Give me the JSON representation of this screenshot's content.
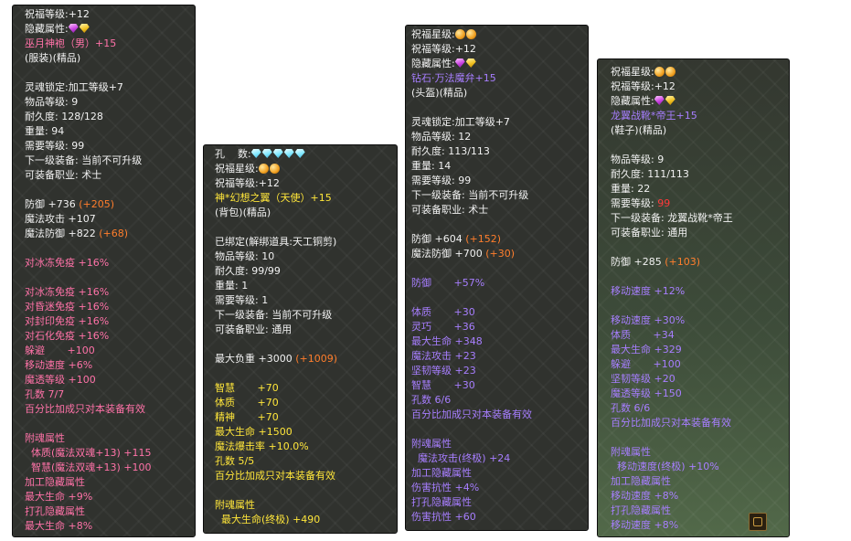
{
  "colors": {
    "white": "#f2f2f2",
    "yellow": "#ffe63a",
    "pink": "#ff72a8",
    "violet": "#a77eff",
    "orange": "#ff7e2c",
    "red": "#ff3a3a"
  },
  "icons": {
    "purple_gem": "purple-diamond-gem-icon",
    "yellow_gem": "yellow-diamond-gem-icon",
    "cyan_gem": "cyan-diamond-gem-icon",
    "star": "gold-star-orb-icon",
    "slot": "item-slot-icon"
  },
  "tooltips": [
    {
      "lines": [
        {
          "c": "t",
          "segs": [
            {
              "t": "祝福等级:+12"
            }
          ]
        },
        {
          "c": "t",
          "segs": [
            {
              "t": "隐藏属性:"
            },
            {
              "icons": [
                "purple",
                "yellow"
              ]
            }
          ]
        },
        {
          "c": "p",
          "segs": [
            {
              "t": "巫月神袍（男）+15"
            }
          ]
        },
        {
          "c": "t",
          "segs": [
            {
              "t": "(服装)(精品)"
            }
          ]
        },
        {
          "c": "t",
          "segs": [
            {
              "t": ""
            }
          ]
        },
        {
          "c": "t",
          "segs": [
            {
              "t": "灵魂锁定:加工等级+7"
            }
          ]
        },
        {
          "c": "t",
          "segs": [
            {
              "t": "物品等级: 9"
            }
          ]
        },
        {
          "c": "t",
          "segs": [
            {
              "t": "耐久度: 128/128"
            }
          ]
        },
        {
          "c": "t",
          "segs": [
            {
              "t": "重量: 94"
            }
          ]
        },
        {
          "c": "t",
          "segs": [
            {
              "t": "需要等级: 99"
            }
          ]
        },
        {
          "c": "t",
          "segs": [
            {
              "t": "下一级装备: 当前不可升级"
            }
          ]
        },
        {
          "c": "t",
          "segs": [
            {
              "t": "可装备职业: 术士"
            }
          ]
        },
        {
          "c": "t",
          "segs": [
            {
              "t": ""
            }
          ]
        },
        {
          "c": "t",
          "segs": [
            {
              "t": "防御 +736 "
            },
            {
              "t": "(+205)",
              "c": "o"
            }
          ]
        },
        {
          "c": "t",
          "segs": [
            {
              "t": "魔法攻击 +107"
            }
          ]
        },
        {
          "c": "t",
          "segs": [
            {
              "t": "魔法防御 +822 "
            },
            {
              "t": "(+68)",
              "c": "o"
            }
          ]
        },
        {
          "c": "t",
          "segs": [
            {
              "t": ""
            }
          ]
        },
        {
          "c": "p",
          "segs": [
            {
              "t": "对冰冻免疫 +16%"
            }
          ]
        },
        {
          "c": "t",
          "segs": [
            {
              "t": ""
            }
          ]
        },
        {
          "c": "p",
          "segs": [
            {
              "t": "对冰冻免疫 +16%"
            }
          ]
        },
        {
          "c": "p",
          "segs": [
            {
              "t": "对昏迷免疫 +16%"
            }
          ]
        },
        {
          "c": "p",
          "segs": [
            {
              "t": "对封印免疫 +16%"
            }
          ]
        },
        {
          "c": "p",
          "segs": [
            {
              "t": "对石化免疫 +16%"
            }
          ]
        },
        {
          "c": "p",
          "segs": [
            {
              "t": "躲避       +100"
            }
          ]
        },
        {
          "c": "p",
          "segs": [
            {
              "t": "移动速度 +6%"
            }
          ]
        },
        {
          "c": "p",
          "segs": [
            {
              "t": "魔透等级 +100"
            }
          ]
        },
        {
          "c": "p",
          "segs": [
            {
              "t": "孔数 7/7"
            }
          ]
        },
        {
          "c": "p",
          "segs": [
            {
              "t": "百分比加成只对本装备有效"
            }
          ]
        },
        {
          "c": "t",
          "segs": [
            {
              "t": ""
            }
          ]
        },
        {
          "c": "p",
          "segs": [
            {
              "t": "附魂属性"
            }
          ]
        },
        {
          "c": "p",
          "segs": [
            {
              "t": "  体质(魔法双魂+13) +115"
            }
          ]
        },
        {
          "c": "p",
          "segs": [
            {
              "t": "  智慧(魔法双魂+13) +100"
            }
          ]
        },
        {
          "c": "p",
          "segs": [
            {
              "t": "加工隐藏属性"
            }
          ]
        },
        {
          "c": "p",
          "segs": [
            {
              "t": "最大生命 +9%"
            }
          ]
        },
        {
          "c": "p",
          "segs": [
            {
              "t": "打孔隐藏属性"
            }
          ]
        },
        {
          "c": "p",
          "segs": [
            {
              "t": "最大生命 +8%"
            }
          ]
        }
      ]
    },
    {
      "lines": [
        {
          "c": "t",
          "segs": [
            {
              "t": "孔    数:"
            },
            {
              "icons": [
                "cyan",
                "cyan",
                "cyan",
                "cyan",
                "cyan"
              ]
            }
          ]
        },
        {
          "c": "t",
          "segs": [
            {
              "t": "祝福星级:"
            },
            {
              "stars": 2
            }
          ]
        },
        {
          "c": "t",
          "segs": [
            {
              "t": "祝福等级:+12"
            }
          ]
        },
        {
          "c": "y",
          "segs": [
            {
              "t": "神*幻想之翼（天使）+15"
            }
          ]
        },
        {
          "c": "t",
          "segs": [
            {
              "t": "(背包)(精品)"
            }
          ]
        },
        {
          "c": "t",
          "segs": [
            {
              "t": ""
            }
          ]
        },
        {
          "c": "t",
          "segs": [
            {
              "t": "已绑定(解绑道具:天工铜剪)"
            }
          ]
        },
        {
          "c": "t",
          "segs": [
            {
              "t": "物品等级: 10"
            }
          ]
        },
        {
          "c": "t",
          "segs": [
            {
              "t": "耐久度: 99/99"
            }
          ]
        },
        {
          "c": "t",
          "segs": [
            {
              "t": "重量: 1"
            }
          ]
        },
        {
          "c": "t",
          "segs": [
            {
              "t": "需要等级: 1"
            }
          ]
        },
        {
          "c": "t",
          "segs": [
            {
              "t": "下一级装备: 当前不可升级"
            }
          ]
        },
        {
          "c": "t",
          "segs": [
            {
              "t": "可装备职业: 通用"
            }
          ]
        },
        {
          "c": "t",
          "segs": [
            {
              "t": ""
            }
          ]
        },
        {
          "c": "t",
          "segs": [
            {
              "t": "最大负重 +3000 "
            },
            {
              "t": "(+1009)",
              "c": "o"
            }
          ]
        },
        {
          "c": "t",
          "segs": [
            {
              "t": ""
            }
          ]
        },
        {
          "c": "y",
          "segs": [
            {
              "t": "智慧       +70"
            }
          ]
        },
        {
          "c": "y",
          "segs": [
            {
              "t": "体质       +70"
            }
          ]
        },
        {
          "c": "y",
          "segs": [
            {
              "t": "精神       +70"
            }
          ]
        },
        {
          "c": "y",
          "segs": [
            {
              "t": "最大生命 +1500"
            }
          ]
        },
        {
          "c": "y",
          "segs": [
            {
              "t": "魔法爆击率 +10.0%"
            }
          ]
        },
        {
          "c": "y",
          "segs": [
            {
              "t": "孔数 5/5"
            }
          ]
        },
        {
          "c": "y",
          "segs": [
            {
              "t": "百分比加成只对本装备有效"
            }
          ]
        },
        {
          "c": "t",
          "segs": [
            {
              "t": ""
            }
          ]
        },
        {
          "c": "y",
          "segs": [
            {
              "t": "附魂属性"
            }
          ]
        },
        {
          "c": "y",
          "segs": [
            {
              "t": "  最大生命(终极) +490"
            }
          ]
        }
      ]
    },
    {
      "lines": [
        {
          "c": "t",
          "segs": [
            {
              "t": "祝福星级:"
            },
            {
              "stars": 2
            }
          ]
        },
        {
          "c": "t",
          "segs": [
            {
              "t": "祝福等级:+12"
            }
          ]
        },
        {
          "c": "t",
          "segs": [
            {
              "t": "隐藏属性:"
            },
            {
              "icons": [
                "purple",
                "yellow"
              ]
            }
          ]
        },
        {
          "c": "v",
          "segs": [
            {
              "t": "钻石·万法魔弁+15"
            }
          ]
        },
        {
          "c": "t",
          "segs": [
            {
              "t": "(头盔)(精品)"
            }
          ]
        },
        {
          "c": "t",
          "segs": [
            {
              "t": ""
            }
          ]
        },
        {
          "c": "t",
          "segs": [
            {
              "t": "灵魂锁定:加工等级+7"
            }
          ]
        },
        {
          "c": "t",
          "segs": [
            {
              "t": "物品等级: 12"
            }
          ]
        },
        {
          "c": "t",
          "segs": [
            {
              "t": "耐久度: 113/113"
            }
          ]
        },
        {
          "c": "t",
          "segs": [
            {
              "t": "重量: 14"
            }
          ]
        },
        {
          "c": "t",
          "segs": [
            {
              "t": "需要等级: 99"
            }
          ]
        },
        {
          "c": "t",
          "segs": [
            {
              "t": "下一级装备: 当前不可升级"
            }
          ]
        },
        {
          "c": "t",
          "segs": [
            {
              "t": "可装备职业: 术士"
            }
          ]
        },
        {
          "c": "t",
          "segs": [
            {
              "t": ""
            }
          ]
        },
        {
          "c": "t",
          "segs": [
            {
              "t": "防御 +604 "
            },
            {
              "t": "(+152)",
              "c": "o"
            }
          ]
        },
        {
          "c": "t",
          "segs": [
            {
              "t": "魔法防御 +700 "
            },
            {
              "t": "(+30)",
              "c": "o"
            }
          ]
        },
        {
          "c": "t",
          "segs": [
            {
              "t": ""
            }
          ]
        },
        {
          "c": "v",
          "segs": [
            {
              "t": "防御       +57%"
            }
          ]
        },
        {
          "c": "t",
          "segs": [
            {
              "t": ""
            }
          ]
        },
        {
          "c": "v",
          "segs": [
            {
              "t": "体质       +30"
            }
          ]
        },
        {
          "c": "v",
          "segs": [
            {
              "t": "灵巧       +36"
            }
          ]
        },
        {
          "c": "v",
          "segs": [
            {
              "t": "最大生命 +348"
            }
          ]
        },
        {
          "c": "v",
          "segs": [
            {
              "t": "魔法攻击 +23"
            }
          ]
        },
        {
          "c": "v",
          "segs": [
            {
              "t": "坚韧等级 +23"
            }
          ]
        },
        {
          "c": "v",
          "segs": [
            {
              "t": "智慧       +30"
            }
          ]
        },
        {
          "c": "v",
          "segs": [
            {
              "t": "孔数 6/6"
            }
          ]
        },
        {
          "c": "v",
          "segs": [
            {
              "t": "百分比加成只对本装备有效"
            }
          ]
        },
        {
          "c": "t",
          "segs": [
            {
              "t": ""
            }
          ]
        },
        {
          "c": "v",
          "segs": [
            {
              "t": "附魂属性"
            }
          ]
        },
        {
          "c": "v",
          "segs": [
            {
              "t": "  魔法攻击(终极) +24"
            }
          ]
        },
        {
          "c": "v",
          "segs": [
            {
              "t": "加工隐藏属性"
            }
          ]
        },
        {
          "c": "v",
          "segs": [
            {
              "t": "伤害抗性 +4%"
            }
          ]
        },
        {
          "c": "v",
          "segs": [
            {
              "t": "打孔隐藏属性"
            }
          ]
        },
        {
          "c": "v",
          "segs": [
            {
              "t": "伤害抗性 +60"
            }
          ]
        }
      ]
    },
    {
      "lines": [
        {
          "c": "t",
          "segs": [
            {
              "t": "祝福星级:"
            },
            {
              "stars": 2
            }
          ]
        },
        {
          "c": "t",
          "segs": [
            {
              "t": "祝福等级:+12"
            }
          ]
        },
        {
          "c": "t",
          "segs": [
            {
              "t": "隐藏属性:"
            },
            {
              "icons": [
                "purple",
                "yellow"
              ]
            }
          ]
        },
        {
          "c": "v",
          "segs": [
            {
              "t": "龙翼战靴*帝王+15"
            }
          ]
        },
        {
          "c": "t",
          "segs": [
            {
              "t": "(鞋子)(精品)"
            }
          ]
        },
        {
          "c": "t",
          "segs": [
            {
              "t": ""
            }
          ]
        },
        {
          "c": "t",
          "segs": [
            {
              "t": "物品等级: 9"
            }
          ]
        },
        {
          "c": "t",
          "segs": [
            {
              "t": "耐久度: 111/113"
            }
          ]
        },
        {
          "c": "t",
          "segs": [
            {
              "t": "重量: 22"
            }
          ]
        },
        {
          "c": "t",
          "segs": [
            {
              "t": "需要等级: "
            },
            {
              "t": "99",
              "c": "r"
            }
          ]
        },
        {
          "c": "t",
          "segs": [
            {
              "t": "下一级装备: 龙翼战靴*帝王"
            }
          ]
        },
        {
          "c": "t",
          "segs": [
            {
              "t": "可装备职业: 通用"
            }
          ]
        },
        {
          "c": "t",
          "segs": [
            {
              "t": ""
            }
          ]
        },
        {
          "c": "t",
          "segs": [
            {
              "t": "防御 +285 "
            },
            {
              "t": "(+103)",
              "c": "o"
            }
          ]
        },
        {
          "c": "t",
          "segs": [
            {
              "t": ""
            }
          ]
        },
        {
          "c": "v",
          "segs": [
            {
              "t": "移动速度 +12%"
            }
          ]
        },
        {
          "c": "t",
          "segs": [
            {
              "t": ""
            }
          ]
        },
        {
          "c": "v",
          "segs": [
            {
              "t": "移动速度 +30%"
            }
          ]
        },
        {
          "c": "v",
          "segs": [
            {
              "t": "体质       +34"
            }
          ]
        },
        {
          "c": "v",
          "segs": [
            {
              "t": "最大生命 +329"
            }
          ]
        },
        {
          "c": "v",
          "segs": [
            {
              "t": "躲避       +100"
            }
          ]
        },
        {
          "c": "v",
          "segs": [
            {
              "t": "坚韧等级 +20"
            }
          ]
        },
        {
          "c": "v",
          "segs": [
            {
              "t": "魔透等级 +150"
            }
          ]
        },
        {
          "c": "v",
          "segs": [
            {
              "t": "孔数 6/6"
            }
          ]
        },
        {
          "c": "v",
          "segs": [
            {
              "t": "百分比加成只对本装备有效"
            }
          ]
        },
        {
          "c": "t",
          "segs": [
            {
              "t": ""
            }
          ]
        },
        {
          "c": "v",
          "segs": [
            {
              "t": "附魂属性"
            }
          ]
        },
        {
          "c": "v",
          "segs": [
            {
              "t": "  移动速度(终极) +10%"
            }
          ]
        },
        {
          "c": "v",
          "segs": [
            {
              "t": "加工隐藏属性"
            }
          ]
        },
        {
          "c": "v",
          "segs": [
            {
              "t": "移动速度 +8%"
            }
          ]
        },
        {
          "c": "v",
          "segs": [
            {
              "t": "打孔隐藏属性"
            }
          ]
        },
        {
          "c": "v",
          "segs": [
            {
              "t": "移动速度 +8%"
            }
          ]
        }
      ]
    }
  ]
}
